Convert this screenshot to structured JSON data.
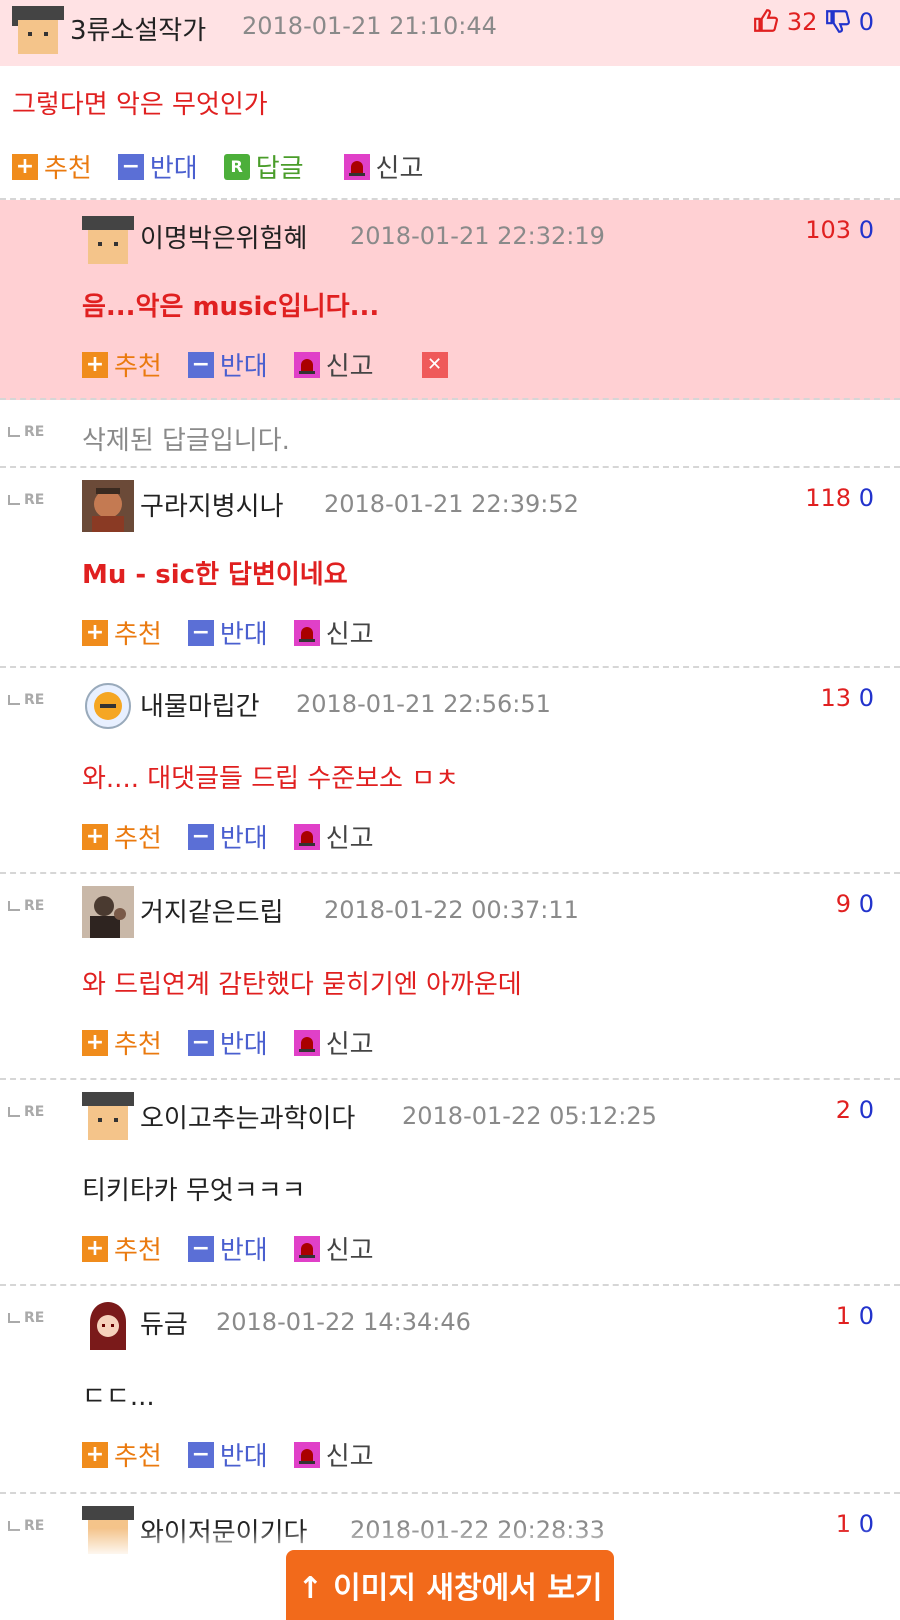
{
  "comments": [
    {
      "nick": "3류소설작가",
      "date": "2018-01-21 21:10:44",
      "up": "32",
      "down": "0",
      "body": "그렇다면 악은 무엇인가",
      "actions": {
        "recommend": "추천",
        "oppose": "반대",
        "reply": "답글",
        "report": "신고"
      }
    },
    {
      "nick": "이명박은위험혜",
      "date": "2018-01-21 22:32:19",
      "up": "103",
      "down": "0",
      "body": "음...악은 music입니다...",
      "actions": {
        "recommend": "추천",
        "oppose": "반대",
        "report": "신고"
      }
    },
    {
      "re": "RE",
      "body": "삭제된 답글입니다."
    },
    {
      "re": "RE",
      "nick": "구라지병시나",
      "date": "2018-01-21 22:39:52",
      "up": "118",
      "down": "0",
      "body": "Mu - sic한 답변이네요",
      "actions": {
        "recommend": "추천",
        "oppose": "반대",
        "report": "신고"
      }
    },
    {
      "re": "RE",
      "nick": "내물마립간",
      "date": "2018-01-21 22:56:51",
      "up": "13",
      "down": "0",
      "body": "와.... 대댓글들 드립 수준보소 ㅁㅊ",
      "actions": {
        "recommend": "추천",
        "oppose": "반대",
        "report": "신고"
      }
    },
    {
      "re": "RE",
      "nick": "거지같은드립",
      "date": "2018-01-22 00:37:11",
      "up": "9",
      "down": "0",
      "body": "와 드립연계 감탄했다 묻히기엔 아까운데",
      "actions": {
        "recommend": "추천",
        "oppose": "반대",
        "report": "신고"
      }
    },
    {
      "re": "RE",
      "nick": "오이고추는과학이다",
      "date": "2018-01-22 05:12:25",
      "up": "2",
      "down": "0",
      "body": "티키타카 무엇ㅋㅋㅋ",
      "actions": {
        "recommend": "추천",
        "oppose": "반대",
        "report": "신고"
      }
    },
    {
      "re": "RE",
      "nick": "듀금",
      "date": "2018-01-22 14:34:46",
      "up": "1",
      "down": "0",
      "body": "ㄷㄷ...",
      "actions": {
        "recommend": "추천",
        "oppose": "반대",
        "report": "신고"
      }
    },
    {
      "re": "RE",
      "nick": "와이저문이기다",
      "date": "2018-01-22 20:28:33",
      "up": "1",
      "down": "0"
    }
  ],
  "float_button": {
    "label": "↑ 이미지 새창에서 보기"
  },
  "icons": {
    "thumbs_up": "thumbs-up-icon",
    "thumbs_down": "thumbs-down-icon",
    "recommend": "plus-icon",
    "oppose": "minus-icon",
    "reply": "reply-icon",
    "report": "siren-icon",
    "delete": "close-icon"
  },
  "colors": {
    "best_bg": "#ffd0d3",
    "header_bg": "#ffe2e4",
    "accent": "#f26a1b",
    "red": "#e02020",
    "blue": "#2233cc"
  }
}
